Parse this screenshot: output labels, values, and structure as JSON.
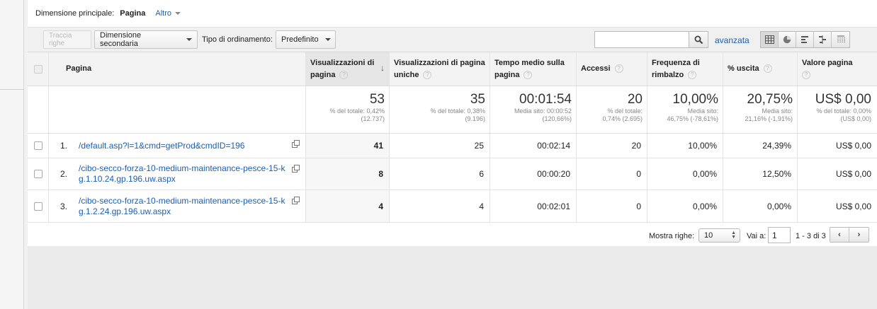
{
  "dimension_bar": {
    "label": "Dimensione principale:",
    "active": "Pagina",
    "other": "Altro"
  },
  "toolbar": {
    "plot_rows": "Traccia righe",
    "secondary_dimension": "Dimensione secondaria",
    "sort_label": "Tipo di ordinamento:",
    "sort_value": "Predefinito",
    "search_placeholder": "",
    "advanced": "avanzata",
    "view_icons": [
      "table-view-icon",
      "pie-view-icon",
      "performance-view-icon",
      "comparison-view-icon",
      "pivot-view-icon"
    ]
  },
  "table": {
    "headers": [
      "Pagina",
      "Visualizzazioni di pagina",
      "Visualizzazioni di pagina uniche",
      "Tempo medio sulla pagina",
      "Accessi",
      "Frequenza di rimbalzo",
      "% uscita",
      "Valore pagina"
    ],
    "totals": [
      {
        "value": "53",
        "sub1": "% del totale: 0,42%",
        "sub2": "(12.737)"
      },
      {
        "value": "35",
        "sub1": "% del totale: 0,38%",
        "sub2": "(9.196)"
      },
      {
        "value": "00:01:54",
        "sub1": "Media sito: 00:00:52",
        "sub2": "(120,66%)"
      },
      {
        "value": "20",
        "sub1": "% del totale:",
        "sub2": "0,74% (2.695)"
      },
      {
        "value": "10,00%",
        "sub1": "Media sito:",
        "sub2": "46,75% (-78,61%)"
      },
      {
        "value": "20,75%",
        "sub1": "Media sito:",
        "sub2": "21,16% (-1,91%)"
      },
      {
        "value": "US$ 0,00",
        "sub1": "% del totale: 0,00%",
        "sub2": "(US$ 0,00)"
      }
    ],
    "rows": [
      {
        "index": "1.",
        "page": "/default.asp?l=1&cmd=getProd&cmdID=196",
        "values": [
          "41",
          "25",
          "00:02:14",
          "20",
          "10,00%",
          "24,39%",
          "US$ 0,00"
        ]
      },
      {
        "index": "2.",
        "page": "/cibo-secco-forza-10-medium-maintenance-pesce-15-kg.1.10.24.gp.196.uw.aspx",
        "values": [
          "8",
          "6",
          "00:00:20",
          "0",
          "0,00%",
          "12,50%",
          "US$ 0,00"
        ]
      },
      {
        "index": "3.",
        "page": "/cibo-secco-forza-10-medium-maintenance-pesce-15-kg.1.2.24.gp.196.uw.aspx",
        "values": [
          "4",
          "4",
          "00:02:01",
          "0",
          "0,00%",
          "0,00%",
          "US$ 0,00"
        ]
      }
    ]
  },
  "footer": {
    "rows_label": "Mostra righe:",
    "rows_value": "10",
    "goto_label": "Vai a:",
    "goto_value": "1",
    "range": "1 - 3 di 3"
  },
  "colors": {
    "link": "#1a5fb4",
    "header_bg": "#f3f3f3",
    "page_bg": "#ebebeb"
  }
}
